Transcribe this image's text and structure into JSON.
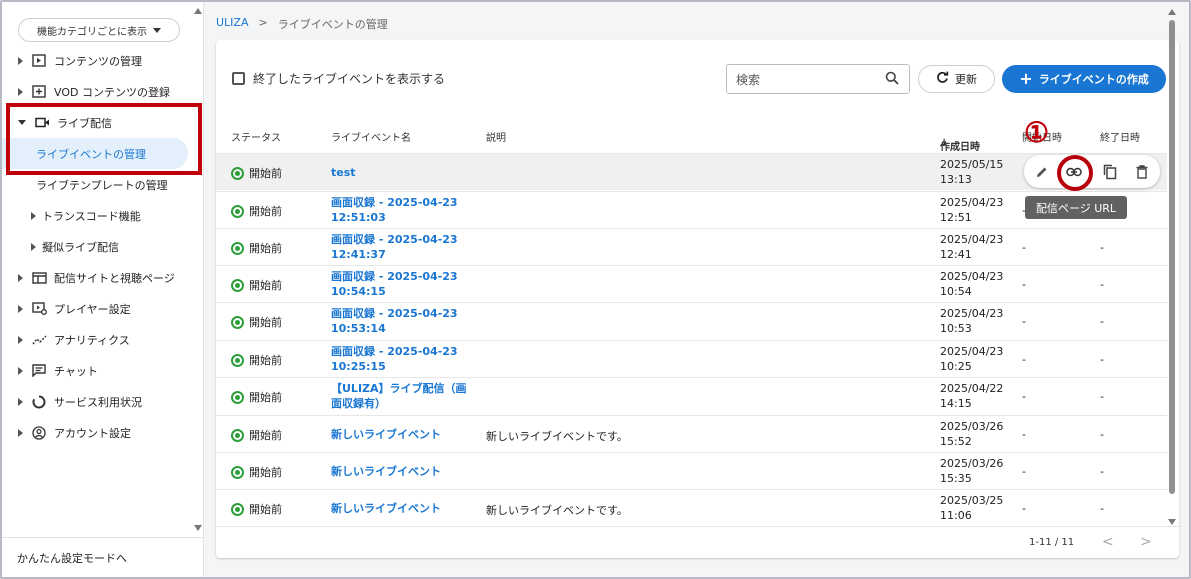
{
  "sidebar": {
    "category_button": "機能カテゴリごとに表示",
    "items": [
      {
        "label": "コンテンツの管理",
        "icon": "content-icon"
      },
      {
        "label": "VOD コンテンツの登録",
        "icon": "vod-add-icon"
      },
      {
        "label": "ライブ配信",
        "icon": "video-camera-icon"
      },
      {
        "label": "ライブイベントの管理"
      },
      {
        "label": "ライブテンプレートの管理"
      },
      {
        "label": "トランスコード機能"
      },
      {
        "label": "擬似ライブ配信"
      },
      {
        "label": "配信サイトと視聴ページ",
        "icon": "site-icon"
      },
      {
        "label": "プレイヤー設定",
        "icon": "player-settings-icon"
      },
      {
        "label": "アナリティクス",
        "icon": "analytics-icon"
      },
      {
        "label": "チャット",
        "icon": "chat-icon"
      },
      {
        "label": "サービス利用状況",
        "icon": "usage-icon"
      },
      {
        "label": "アカウント設定",
        "icon": "account-icon"
      }
    ],
    "simple_mode": "かんたん設定モードへ"
  },
  "breadcrumb": {
    "home": "ULIZA",
    "sep": ">",
    "current": "ライブイベントの管理"
  },
  "toolbar": {
    "show_ended": "終了したライブイベントを表示する",
    "search_placeholder": "検索",
    "refresh": "更新",
    "create": "ライブイベントの作成"
  },
  "table": {
    "headers": {
      "status": "ステータス",
      "name": "ライブイベント名",
      "desc": "説明",
      "created": "作成日時",
      "start": "開始日時",
      "end": "終了日時"
    },
    "rows": [
      {
        "status": "開始前",
        "name": "test",
        "desc": "",
        "created_date": "2025/05/15",
        "created_time": "13:13",
        "start": "-",
        "end": "-"
      },
      {
        "status": "開始前",
        "name": "画面収録 - 2025-04-23 12:51:03",
        "desc": "",
        "created_date": "2025/04/23",
        "created_time": "12:51",
        "start": "-",
        "end": "-"
      },
      {
        "status": "開始前",
        "name": "画面収録 - 2025-04-23 12:41:37",
        "desc": "",
        "created_date": "2025/04/23",
        "created_time": "12:41",
        "start": "-",
        "end": "-"
      },
      {
        "status": "開始前",
        "name": "画面収録 - 2025-04-23 10:54:15",
        "desc": "",
        "created_date": "2025/04/23",
        "created_time": "10:54",
        "start": "-",
        "end": "-"
      },
      {
        "status": "開始前",
        "name": "画面収録 - 2025-04-23 10:53:14",
        "desc": "",
        "created_date": "2025/04/23",
        "created_time": "10:53",
        "start": "-",
        "end": "-"
      },
      {
        "status": "開始前",
        "name": "画面収録 - 2025-04-23 10:25:15",
        "desc": "",
        "created_date": "2025/04/23",
        "created_time": "10:25",
        "start": "-",
        "end": "-"
      },
      {
        "status": "開始前",
        "name": "【ULIZA】ライブ配信（画面収録有）",
        "desc": "",
        "created_date": "2025/04/22",
        "created_time": "14:15",
        "start": "-",
        "end": "-"
      },
      {
        "status": "開始前",
        "name": "新しいライブイベント",
        "desc": "新しいライブイベントです。",
        "created_date": "2025/03/26",
        "created_time": "15:52",
        "start": "-",
        "end": "-"
      },
      {
        "status": "開始前",
        "name": "新しいライブイベント",
        "desc": "",
        "created_date": "2025/03/26",
        "created_time": "15:35",
        "start": "-",
        "end": "-"
      },
      {
        "status": "開始前",
        "name": "新しいライブイベント",
        "desc": "新しいライブイベントです。",
        "created_date": "2025/03/25",
        "created_time": "11:06",
        "start": "-",
        "end": "-"
      }
    ]
  },
  "row_actions": {
    "tooltip": "配信ページ URL",
    "annotation": "①"
  },
  "pagination": {
    "range": "1-11 / 11",
    "prev": "<",
    "next": ">"
  },
  "colors": {
    "accent": "#1976d2",
    "status_green": "#2e9d3c",
    "annotation_red": "#c0000a"
  }
}
